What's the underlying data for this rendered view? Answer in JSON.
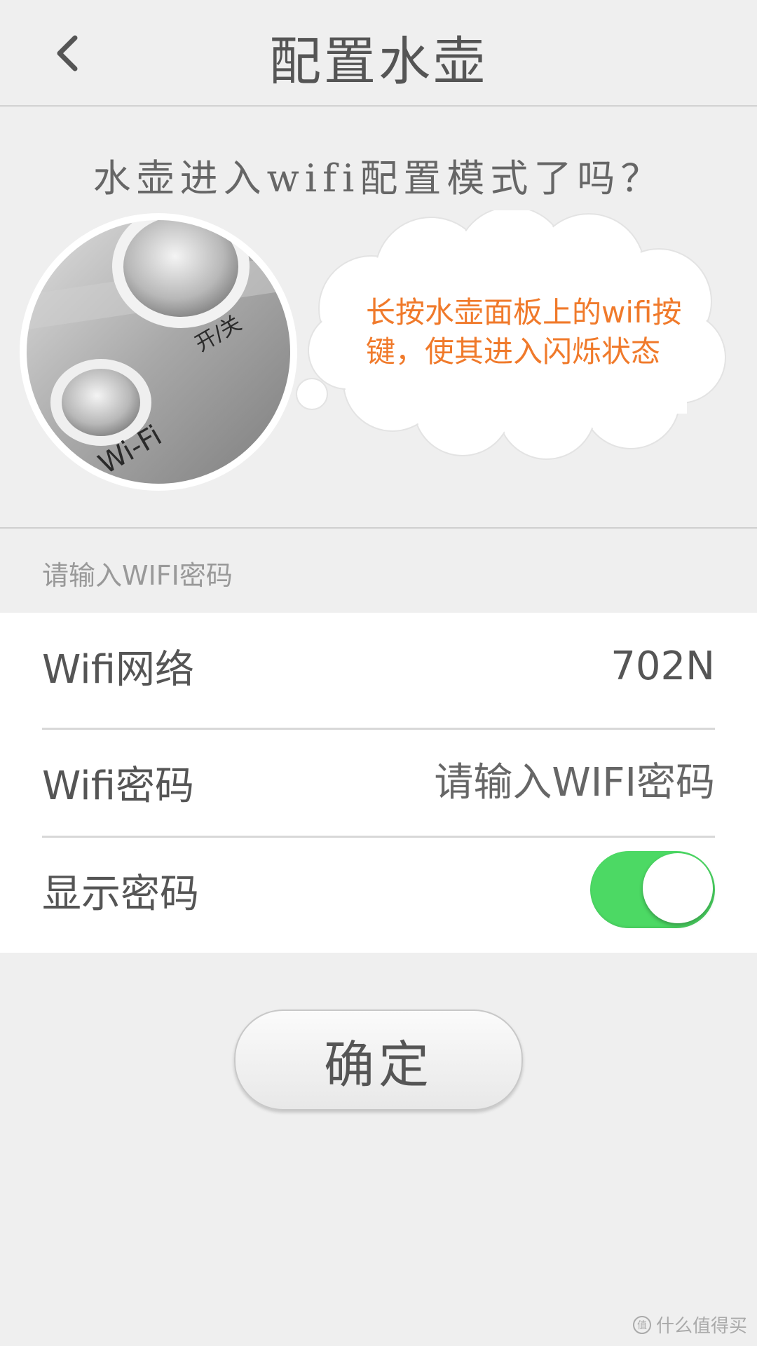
{
  "header": {
    "title": "配置水壶",
    "back_icon": "chevron-left-icon"
  },
  "prompt": {
    "question": "水壶进入wifi配置模式了吗？"
  },
  "illustration": {
    "power_label": "开/关",
    "wifi_label": "Wi-Fi",
    "bubble_text": "长按水壶面板上的wifi按键，使其进入闪烁状态"
  },
  "form": {
    "section_label": "请输入WIFI密码",
    "network": {
      "label": "Wifi网络",
      "value": "702N"
    },
    "password": {
      "label": "Wifi密码",
      "placeholder": "请输入WIFI密码"
    },
    "show_password": {
      "label": "显示密码",
      "enabled": true
    }
  },
  "confirm": {
    "label": "确定"
  },
  "watermark": {
    "text": "什么值得买"
  },
  "colors": {
    "accent_orange": "#f07a2b",
    "toggle_green": "#4cd964",
    "background": "#efefef"
  }
}
